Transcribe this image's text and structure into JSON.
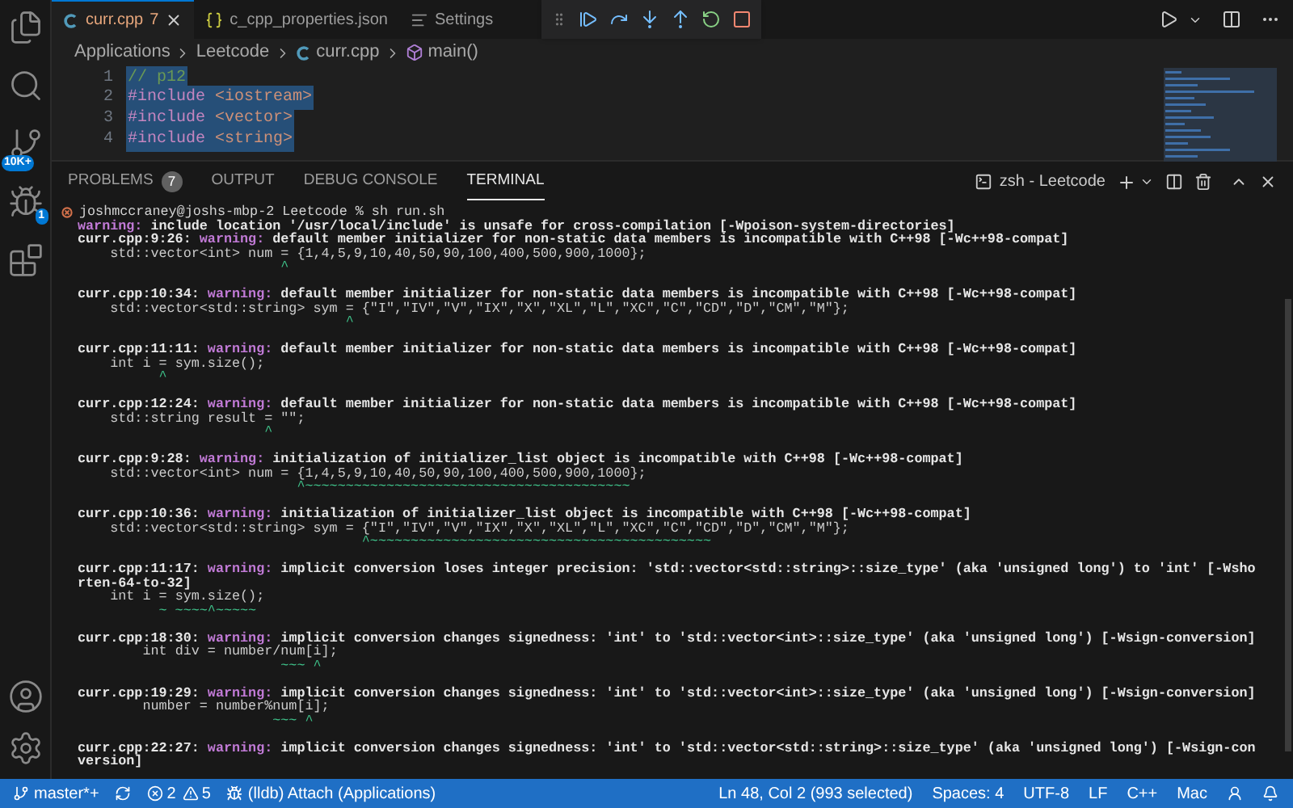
{
  "activity_bar": {
    "items": [
      {
        "kind": "explorer"
      },
      {
        "kind": "search"
      },
      {
        "kind": "source_control",
        "badge": "10K+"
      },
      {
        "kind": "debug",
        "badge": "1"
      },
      {
        "kind": "extensions"
      }
    ],
    "bottom": [
      {
        "kind": "account"
      },
      {
        "kind": "settings"
      }
    ]
  },
  "tabs": [
    {
      "kind": "cpp",
      "label": "curr.cpp",
      "problems": "7",
      "selected": true
    },
    {
      "kind": "json",
      "label": "c_cpp_properties.json",
      "selected": false
    },
    {
      "kind": "settings",
      "label": "Settings",
      "selected": false
    }
  ],
  "breadcrumbs": [
    {
      "kind": "folder",
      "label": "Applications"
    },
    {
      "kind": "folder",
      "label": "Leetcode"
    },
    {
      "kind": "cpp",
      "label": "curr.cpp"
    },
    {
      "kind": "function",
      "label": "main()"
    }
  ],
  "editor": {
    "lines": [
      {
        "number": "1",
        "selected": true,
        "tokens": [
          {
            "kind": "comment",
            "text": "// p12"
          }
        ]
      },
      {
        "number": "2",
        "selected": true,
        "tokens": [
          {
            "kind": "directive",
            "text": "#include"
          },
          {
            "kind": "string",
            "text": " <iostream>"
          }
        ]
      },
      {
        "number": "3",
        "selected": true,
        "tokens": [
          {
            "kind": "directive",
            "text": "#include"
          },
          {
            "kind": "string",
            "text": " <vector>"
          }
        ]
      },
      {
        "number": "4",
        "selected": true,
        "tokens": [
          {
            "kind": "directive",
            "text": "#include"
          },
          {
            "kind": "string",
            "text": " <string>"
          }
        ]
      }
    ]
  },
  "panel": {
    "tabs": [
      {
        "label": "PROBLEMS",
        "badge": "7",
        "selected": false
      },
      {
        "label": "OUTPUT",
        "selected": false
      },
      {
        "label": "DEBUG CONSOLE",
        "selected": false
      },
      {
        "label": "TERMINAL",
        "selected": true
      }
    ],
    "terminal_title": "zsh - Leetcode",
    "lines": [
      {
        "kind": "prompt",
        "text": "joshmccraney@joshs-mbp-2 Leetcode % sh run.sh"
      },
      {
        "kind": "warning",
        "label": "warning:",
        "message": "include location '/usr/local/include' is unsafe for cross-compilation [-Wpoison-system-directories]"
      },
      {
        "kind": "warning",
        "location": "curr.cpp:9:26:",
        "label": "warning:",
        "message": "default member initializer for non-static data members is incompatible with C++98 [-Wc++98-compat]"
      },
      {
        "kind": "code",
        "text": "    std::vector<int> num = {1,4,5,9,10,40,50,90,100,400,500,900,1000};"
      },
      {
        "kind": "marker",
        "text": "                         ^"
      },
      {
        "kind": "blank"
      },
      {
        "kind": "warning",
        "location": "curr.cpp:10:34:",
        "label": "warning:",
        "message": "default member initializer for non-static data members is incompatible with C++98 [-Wc++98-compat]"
      },
      {
        "kind": "code",
        "text": "    std::vector<std::string> sym = {\"I\",\"IV\",\"V\",\"IX\",\"X\",\"XL\",\"L\",\"XC\",\"C\",\"CD\",\"D\",\"CM\",\"M\"};"
      },
      {
        "kind": "marker",
        "text": "                                 ^"
      },
      {
        "kind": "blank"
      },
      {
        "kind": "warning",
        "location": "curr.cpp:11:11:",
        "label": "warning:",
        "message": "default member initializer for non-static data members is incompatible with C++98 [-Wc++98-compat]"
      },
      {
        "kind": "code",
        "text": "    int i = sym.size();"
      },
      {
        "kind": "marker",
        "text": "          ^"
      },
      {
        "kind": "blank"
      },
      {
        "kind": "warning",
        "location": "curr.cpp:12:24:",
        "label": "warning:",
        "message": "default member initializer for non-static data members is incompatible with C++98 [-Wc++98-compat]"
      },
      {
        "kind": "code",
        "text": "    std::string result = \"\";"
      },
      {
        "kind": "marker",
        "text": "                       ^"
      },
      {
        "kind": "blank"
      },
      {
        "kind": "warning",
        "location": "curr.cpp:9:28:",
        "label": "warning:",
        "message": "initialization of initializer_list object is incompatible with C++98 [-Wc++98-compat]"
      },
      {
        "kind": "code",
        "text": "    std::vector<int> num = {1,4,5,9,10,40,50,90,100,400,500,900,1000};"
      },
      {
        "kind": "marker",
        "text": "                           ^~~~~~~~~~~~~~~~~~~~~~~~~~~~~~~~~~~~~~~~~"
      },
      {
        "kind": "blank"
      },
      {
        "kind": "warning",
        "location": "curr.cpp:10:36:",
        "label": "warning:",
        "message": "initialization of initializer_list object is incompatible with C++98 [-Wc++98-compat]"
      },
      {
        "kind": "code",
        "text": "    std::vector<std::string> sym = {\"I\",\"IV\",\"V\",\"IX\",\"X\",\"XL\",\"L\",\"XC\",\"C\",\"CD\",\"D\",\"CM\",\"M\"};"
      },
      {
        "kind": "marker",
        "text": "                                   ^~~~~~~~~~~~~~~~~~~~~~~~~~~~~~~~~~~~~~~~~~~"
      },
      {
        "kind": "blank"
      },
      {
        "kind": "warning",
        "location": "curr.cpp:11:17:",
        "label": "warning:",
        "message": "implicit conversion loses integer precision: 'std::vector<std::string>::size_type' (aka 'unsigned long') to 'int' [-Wshorten-64-to-32]"
      },
      {
        "kind": "code",
        "text": "    int i = sym.size();"
      },
      {
        "kind": "marker",
        "text": "          ~ ~~~~^~~~~~"
      },
      {
        "kind": "blank"
      },
      {
        "kind": "warning",
        "location": "curr.cpp:18:30:",
        "label": "warning:",
        "message": "implicit conversion changes signedness: 'int' to 'std::vector<int>::size_type' (aka 'unsigned long') [-Wsign-conversion]"
      },
      {
        "kind": "code",
        "text": "        int div = number/num[i];"
      },
      {
        "kind": "marker",
        "text": "                         ~~~ ^"
      },
      {
        "kind": "blank"
      },
      {
        "kind": "warning",
        "location": "curr.cpp:19:29:",
        "label": "warning:",
        "message": "implicit conversion changes signedness: 'int' to 'std::vector<int>::size_type' (aka 'unsigned long') [-Wsign-conversion]"
      },
      {
        "kind": "code",
        "text": "        number = number%num[i];"
      },
      {
        "kind": "marker",
        "text": "                        ~~~ ^"
      },
      {
        "kind": "blank"
      },
      {
        "kind": "warning",
        "location": "curr.cpp:22:27:",
        "label": "warning:",
        "message": "implicit conversion changes signedness: 'int' to 'std::vector<std::string>::size_type' (aka 'unsigned long') [-Wsign-conversion]"
      }
    ]
  },
  "status_bar": {
    "left": [
      {
        "kind": "branch",
        "text": "master*+"
      },
      {
        "kind": "sync"
      },
      {
        "kind": "problems",
        "errors": "2",
        "warnings": "5"
      },
      {
        "kind": "debug",
        "text": "(lldb) Attach (Applications)"
      }
    ],
    "right": [
      {
        "kind": "text",
        "text": "Ln 48, Col 2 (993 selected)"
      },
      {
        "kind": "text",
        "text": "Spaces: 4"
      },
      {
        "kind": "text",
        "text": "UTF-8"
      },
      {
        "kind": "text",
        "text": "LF"
      },
      {
        "kind": "text",
        "text": "C++"
      },
      {
        "kind": "text",
        "text": "Mac"
      },
      {
        "kind": "feedback"
      },
      {
        "kind": "notifications"
      }
    ]
  }
}
